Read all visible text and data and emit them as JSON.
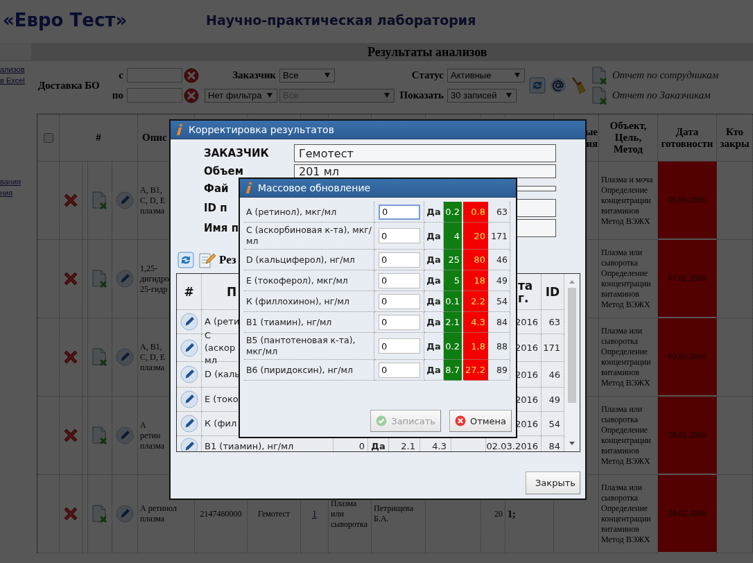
{
  "header": {
    "logo": "«Евро Тест»",
    "subtitle": "Научно-практическая лаборатория"
  },
  "sidebar": {
    "links_top": [
      "ализов",
      "в Excel"
    ],
    "links_bottom": [
      "вания",
      "ния"
    ]
  },
  "page_title": "Результаты анализов",
  "filters": {
    "delivery_label": "Доставка БО",
    "from_label": "с",
    "to_label": "по",
    "customer": {
      "label": "Заказчик",
      "value": "Все"
    },
    "filter_type": {
      "value": "Нет фильтра"
    },
    "filter_value": {
      "value": "Все",
      "disabled": true
    },
    "status": {
      "label": "Статус",
      "value": "Активные"
    },
    "show": {
      "label": "Показать",
      "value": "30 записей"
    },
    "reports": [
      "Отчет по сотрудникам",
      "Отчет по Заказчикам"
    ]
  },
  "table": {
    "select_all": {
      "checked": false
    },
    "columns": [
      "#",
      "Опис",
      "ые ия",
      "Объект, Цель, Метод",
      "Дата готовности",
      "Кто закры"
    ],
    "rows": [
      {
        "description": "А, В1, С, D, Е плазма",
        "object": "Плазма и моча Определение концентрации витаминов Метод ВЭЖХ",
        "ready_date": "05.03.2016",
        "overdue": true
      },
      {
        "description": "1,25-дигидро 25-гидр",
        "object": "Плазма или сыворотка Определение концентрации витаминов Метод ВЭЖХ",
        "ready_date": "07.02.2016",
        "overdue": true
      },
      {
        "description": "А, В1, С, D, Е плазма",
        "object": "Плазма или сыворотка Определение концентрации витаминов Метод ВЭЖХ",
        "ready_date": "05.03.2016",
        "overdue": true
      },
      {
        "description": "А ретин плазма",
        "object": "Плазма или сыворотка Определение концентрации витаминов Метод ВЭЖХ",
        "ready_date": "28.02.2016",
        "overdue": true
      },
      {
        "description": "А ретинол плазма",
        "number": "2147480000",
        "customer": "Гемотест",
        "count": "1",
        "sample": "Плазма или сыворотка",
        "person": "Петрищева Б.А.",
        "column_13": "20",
        "column_14": "1;",
        "object": "Плазма или сыворотка Определение концентрации витаминов Метод ВЭЖХ",
        "ready_date": "28.02.2016",
        "overdue": true
      }
    ]
  },
  "edit_dialog": {
    "title": "Корректировка результатов",
    "fields": [
      {
        "label": "ЗАКАЗЧИК",
        "value": "Гемотест",
        "kind": "box"
      },
      {
        "label": "Объем",
        "value": "201 мл",
        "kind": "box"
      },
      {
        "label": "Фай",
        "kind": "strip"
      },
      {
        "label": "ID п",
        "kind": "box"
      },
      {
        "label": "Имя п",
        "kind": "box"
      }
    ],
    "section_label": "Рез",
    "table": {
      "columns": [
        "#",
        "П",
        "та г.",
        "ID"
      ],
      "rows": [
        {
          "name": "А (рети",
          "date": "2016",
          "id": "63"
        },
        {
          "name": "С (аскор мл",
          "date": "2016",
          "id": "171"
        },
        {
          "name": "D (каль",
          "date": "2016",
          "id": "46"
        },
        {
          "name": "Е (токо",
          "date": "2016",
          "id": "49"
        },
        {
          "name": "К (фил",
          "date": "2016",
          "id": "54"
        },
        {
          "name": "В1 (тиамин), нг/мл",
          "value": "0",
          "flag": "Да",
          "low": "2.1",
          "high": "4.3",
          "date": "02.03.2016",
          "id": "84"
        }
      ]
    },
    "close_button": "Закрыть"
  },
  "mass_dialog": {
    "title": "Массовое обновление",
    "rows": [
      {
        "name": "А (ретинол), мкг/мл",
        "value": "0",
        "focused": true,
        "flag": "Да",
        "low": "0.2",
        "high": "0.8",
        "id": "63"
      },
      {
        "name": "С (аскорбиновая к-та), мкг/мл",
        "value": "0",
        "focused": false,
        "flag": "Да",
        "low": "4",
        "high": "20",
        "id": "171"
      },
      {
        "name": "D (кальциферол), нг/мл",
        "value": "0",
        "focused": false,
        "flag": "Да",
        "low": "25",
        "high": "80",
        "id": "46"
      },
      {
        "name": "Е (токоферол), мкг/мл",
        "value": "0",
        "focused": false,
        "flag": "Да",
        "low": "5",
        "high": "18",
        "id": "49"
      },
      {
        "name": "К (филлохинон), нг/мл",
        "value": "0",
        "focused": false,
        "flag": "Да",
        "low": "0.1",
        "high": "2.2",
        "id": "54"
      },
      {
        "name": "В1 (тиамин), нг/мл",
        "value": "0",
        "focused": false,
        "flag": "Да",
        "low": "2.1",
        "high": "4.3",
        "id": "84"
      },
      {
        "name": "В5 (пантотеновая к-та), мкг/мл",
        "value": "0",
        "focused": false,
        "flag": "Да",
        "low": "0.2",
        "high": "1.8",
        "id": "88"
      },
      {
        "name": "В6 (пиридоксин), нг/мл",
        "value": "0",
        "focused": false,
        "flag": "Да",
        "low": "8.7",
        "high": "27.2",
        "id": "89"
      }
    ],
    "buttons": [
      {
        "label": "Записать",
        "kind": "save",
        "disabled": true
      },
      {
        "label": "Отмена",
        "kind": "cancel",
        "disabled": false
      }
    ]
  }
}
